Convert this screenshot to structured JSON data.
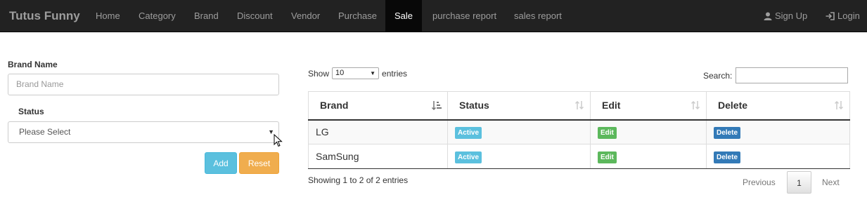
{
  "navbar": {
    "brand": "Tutus Funny",
    "items": [
      {
        "label": "Home",
        "active": false
      },
      {
        "label": "Category",
        "active": false
      },
      {
        "label": "Brand",
        "active": false
      },
      {
        "label": "Discount",
        "active": false
      },
      {
        "label": "Vendor",
        "active": false
      },
      {
        "label": "Purchase",
        "active": false
      },
      {
        "label": "Sale",
        "active": true
      },
      {
        "label": "purchase report",
        "active": false
      },
      {
        "label": "sales report",
        "active": false
      }
    ],
    "signup_label": "Sign Up",
    "login_label": "Login"
  },
  "form": {
    "brand_name_label": "Brand Name",
    "brand_name_placeholder": "Brand Name",
    "brand_name_value": "",
    "status_label": "Status",
    "status_selected": "Please Select",
    "add_label": "Add",
    "reset_label": "Reset"
  },
  "table": {
    "show_label": "Show",
    "entries_label": "entries",
    "page_length": "10",
    "search_label": "Search:",
    "search_value": "",
    "columns": [
      "Brand",
      "Status",
      "Edit",
      "Delete"
    ],
    "rows": [
      {
        "brand": "LG",
        "status": "Active",
        "edit": "Edit",
        "delete": "Delete"
      },
      {
        "brand": "SamSung",
        "status": "Active",
        "edit": "Edit",
        "delete": "Delete"
      }
    ],
    "info": "Showing 1 to 2 of 2 entries",
    "pagination": {
      "previous": "Previous",
      "current_page": "1",
      "next": "Next"
    }
  },
  "colors": {
    "navbar_bg": "#222222",
    "active_label": "#5bc0de",
    "edit_label": "#5cb85c",
    "delete_label": "#337ab7",
    "add_button": "#5bc0de",
    "reset_button": "#f0ad4e"
  },
  "icons": {
    "signup": "user-icon",
    "login": "login-icon",
    "sort": "sort-icon",
    "cursor": "mouse-pointer-icon"
  }
}
